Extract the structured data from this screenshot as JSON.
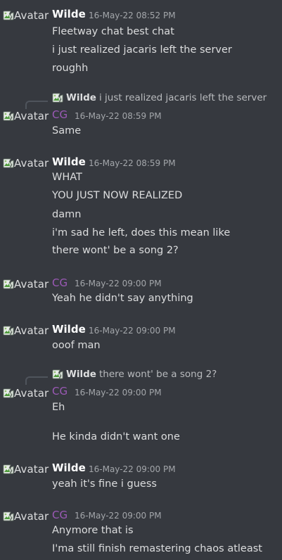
{
  "colors": {
    "background": "#36393f",
    "wilde_name": "#ffffff",
    "cg_name": "#9b59b6",
    "timestamp": "#a3a6aa",
    "message_text": "#dcddde"
  },
  "avatar_alt": "Avatar",
  "messages": [
    {
      "author": "Wilde",
      "timestamp": "16-May-22 08:52 PM",
      "lines": [
        "Fleetway chat best chat",
        "i just realized jacaris left the server",
        "roughh"
      ]
    },
    {
      "reply_to": {
        "author": "Wilde",
        "text": "i just realized jacaris left the server"
      },
      "author": "CG",
      "timestamp": "16-May-22 08:59 PM",
      "lines": [
        "Same"
      ]
    },
    {
      "author": "Wilde",
      "timestamp": "16-May-22 08:59 PM",
      "lines": [
        "WHAT",
        "YOU JUST NOW REALIZED",
        "damn",
        "i'm sad he left, does this mean like",
        "there wont' be a song 2?"
      ]
    },
    {
      "author": "CG",
      "timestamp": "16-May-22 09:00 PM",
      "lines": [
        "Yeah he didn't say anything"
      ]
    },
    {
      "author": "Wilde",
      "timestamp": "16-May-22 09:00 PM",
      "lines": [
        "ooof man"
      ]
    },
    {
      "reply_to": {
        "author": "Wilde",
        "text": "there wont' be a song 2?"
      },
      "author": "CG",
      "timestamp": "16-May-22 09:00 PM",
      "lines": [
        "Eh",
        "He kinda didn't want one"
      ]
    },
    {
      "author": "Wilde",
      "timestamp": "16-May-22 09:00 PM",
      "lines": [
        "yeah it's fine i guess"
      ]
    },
    {
      "author": "CG",
      "timestamp": "16-May-22 09:00 PM",
      "lines": [
        "Anymore that is",
        "I'ma still finish remastering chaos atleast"
      ]
    }
  ]
}
